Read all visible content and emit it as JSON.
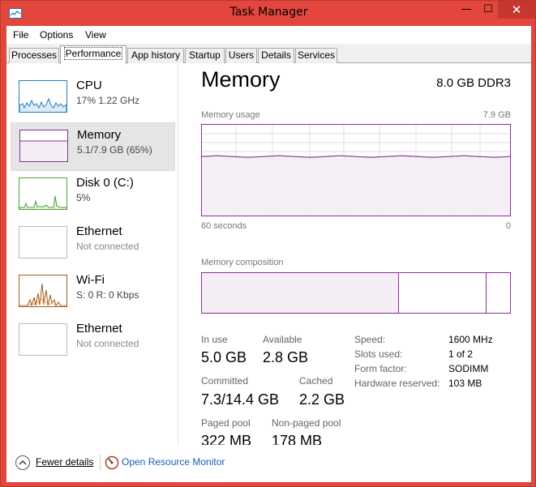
{
  "window": {
    "title": "Task Manager",
    "minimize_glyph": "—",
    "maximize_glyph": "☐",
    "close_glyph": "✕",
    "accent_color": "#e3463c"
  },
  "menu": [
    "File",
    "Options",
    "View"
  ],
  "tabs": [
    "Processes",
    "Performance",
    "App history",
    "Startup",
    "Users",
    "Details",
    "Services"
  ],
  "active_tab": "Performance",
  "sidebar": {
    "items": [
      {
        "title": "CPU",
        "subtitle": "17% 1.22 GHz",
        "color": "#1f7fc4"
      },
      {
        "title": "Memory",
        "subtitle": "5.1/7.9 GB (65%)",
        "color": "#8b2d9a",
        "selected": true
      },
      {
        "title": "Disk 0 (C:)",
        "subtitle": "5%",
        "color": "#4da332"
      },
      {
        "title": "Ethernet",
        "subtitle": "Not connected",
        "color": "#a05a1b"
      },
      {
        "title": "Wi-Fi",
        "subtitle": "S: 0 R: 0 Kbps",
        "color": "#a05a1b"
      },
      {
        "title": "Ethernet",
        "subtitle": "Not connected",
        "color": "#a05a1b"
      }
    ]
  },
  "main": {
    "title": "Memory",
    "spec": "8.0 GB DDR3",
    "usage_caption": "Memory usage",
    "usage_max": "7.9 GB",
    "time_left": "60 seconds",
    "time_right": "0",
    "usage_level_percent": 65,
    "composition_caption": "Memory composition",
    "composition_in_use_fraction": 0.64,
    "composition_modified_fraction": 0.92,
    "stats": {
      "in_use_label": "In use",
      "in_use": "5.0 GB",
      "available_label": "Available",
      "available": "2.8 GB",
      "committed_label": "Committed",
      "committed": "7.3/14.4 GB",
      "cached_label": "Cached",
      "cached": "2.2 GB",
      "paged_label": "Paged pool",
      "paged": "322 MB",
      "nonpaged_label": "Non-paged pool",
      "nonpaged": "178 MB"
    },
    "details": {
      "speed_label": "Speed:",
      "speed": "1600 MHz",
      "slots_label": "Slots used:",
      "slots": "1 of 2",
      "form_label": "Form factor:",
      "form": "SODIMM",
      "reserved_label": "Hardware reserved:",
      "reserved": "103 MB"
    }
  },
  "footer": {
    "fewer_details": "Fewer details",
    "open_resource_monitor": "Open Resource Monitor"
  }
}
